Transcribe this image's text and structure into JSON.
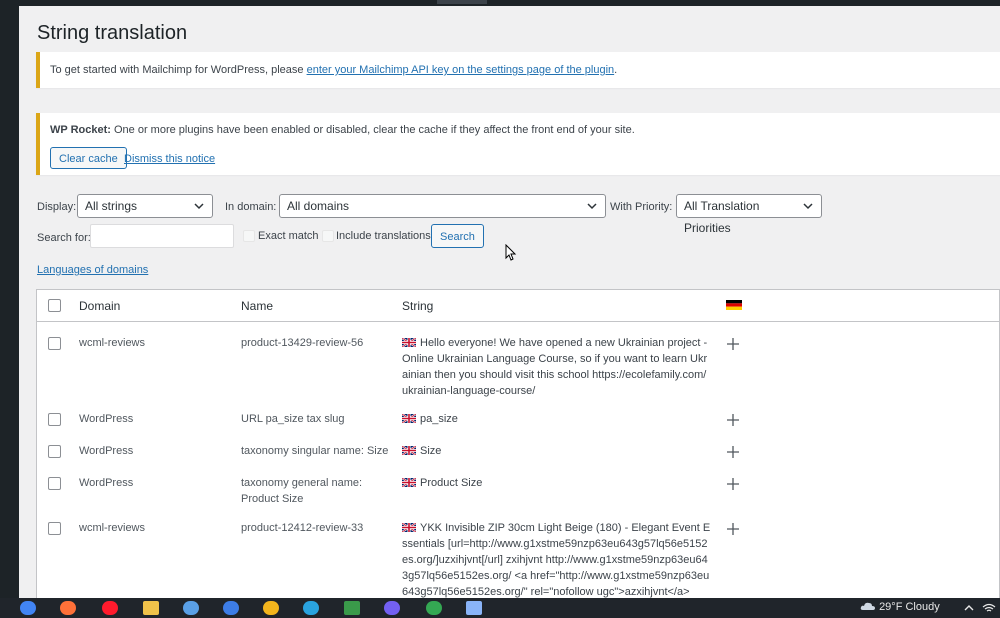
{
  "page": {
    "title": "String translation"
  },
  "notices": {
    "mailchimp": {
      "text": "To get started with Mailchimp for WordPress, please",
      "link": "enter your Mailchimp API key on the settings page of the plugin",
      "suffix": "."
    },
    "wprocket": {
      "bold": "WP Rocket:",
      "text": "One or more plugins have been enabled or disabled, clear the cache if they affect the front end of your site.",
      "clear_button": "Clear cache",
      "dismiss_link": "Dismiss this notice"
    }
  },
  "filters": {
    "display_label": "Display:",
    "display_value": "All strings",
    "domain_label": "In domain:",
    "domain_value": "All domains",
    "priority_label": "With Priority:",
    "priority_value": "All Translation Priorities",
    "search_label": "Search for:",
    "search_value": "",
    "exact_match": "Exact match",
    "include_translations": "Include translations",
    "search_button": "Search",
    "languages_link": "Languages of domains"
  },
  "table": {
    "headers": {
      "domain": "Domain",
      "name": "Name",
      "string": "String"
    },
    "rows": [
      {
        "domain": "wcml-reviews",
        "name": "product-13429-review-56",
        "string": "Hello everyone! We have opened a new Ukrainian project - Online Ukrainian Language Course, so if you want to learn Ukrainian then you should visit this school https://ecolefamily.com/ukrainian-language-course/"
      },
      {
        "domain": "WordPress",
        "name": "URL pa_size tax slug",
        "string": "pa_size"
      },
      {
        "domain": "WordPress",
        "name": "taxonomy singular name: Size",
        "string": "Size"
      },
      {
        "domain": "WordPress",
        "name": "taxonomy general name: Product Size",
        "string": "Product Size"
      },
      {
        "domain": "wcml-reviews",
        "name": "product-12412-review-33",
        "string": "YKK Invisible ZIP 30cm Light Beige (180) - Elegant Event Essentials [url=http://www.g1xstme59nzp63eu643g57lq56e5152es.org/]uzxihjvnt[/url] zxihjvnt http://www.g1xstme59nzp63eu643g57lq56e5152es.org/ <a href=\"http://www.g1xstme59nzp63eu643g57lq56e5152es.org/\" rel=\"nofollow ugc\">azxihjvnt</a>"
      }
    ]
  },
  "taskbar": {
    "weather": "29°F  Cloudy"
  }
}
